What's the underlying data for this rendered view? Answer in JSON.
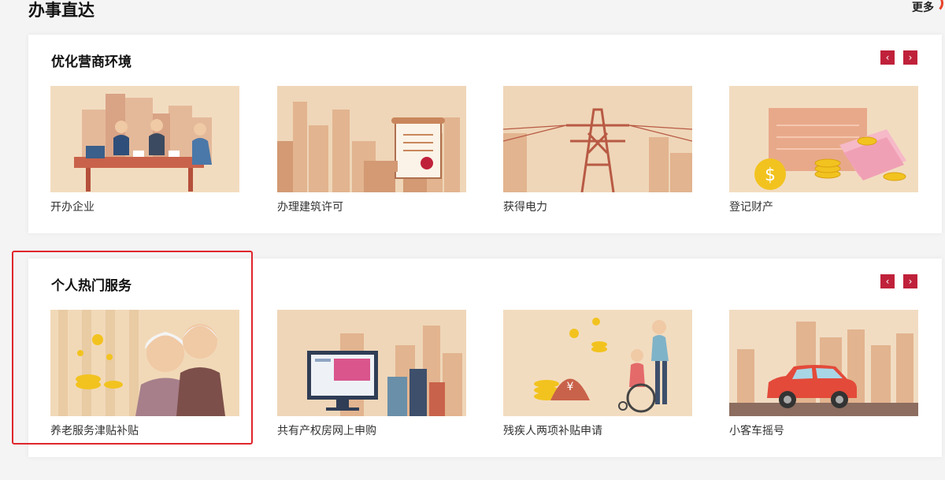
{
  "page": {
    "title": "办事直达",
    "more_label": "更多"
  },
  "sections": [
    {
      "title": "优化营商环境",
      "cards": [
        {
          "label": "开办企业",
          "icon": "business-meeting-illustration"
        },
        {
          "label": "办理建筑许可",
          "icon": "certificate-illustration"
        },
        {
          "label": "获得电力",
          "icon": "power-tower-illustration"
        },
        {
          "label": "登记财产",
          "icon": "coins-illustration"
        }
      ]
    },
    {
      "title": "个人热门服务",
      "cards": [
        {
          "label": "养老服务津贴补贴",
          "icon": "elderly-couple-illustration"
        },
        {
          "label": "共有产权房网上申购",
          "icon": "monitor-city-illustration"
        },
        {
          "label": "残疾人两项补贴申请",
          "icon": "wheelchair-illustration"
        },
        {
          "label": "小客车摇号",
          "icon": "car-illustration"
        }
      ]
    }
  ],
  "nav": {
    "prev": "‹",
    "next": "›"
  },
  "colors": {
    "accent": "#c0213a",
    "card_bg": "#f2dcc0",
    "highlight": "#e0262c"
  }
}
